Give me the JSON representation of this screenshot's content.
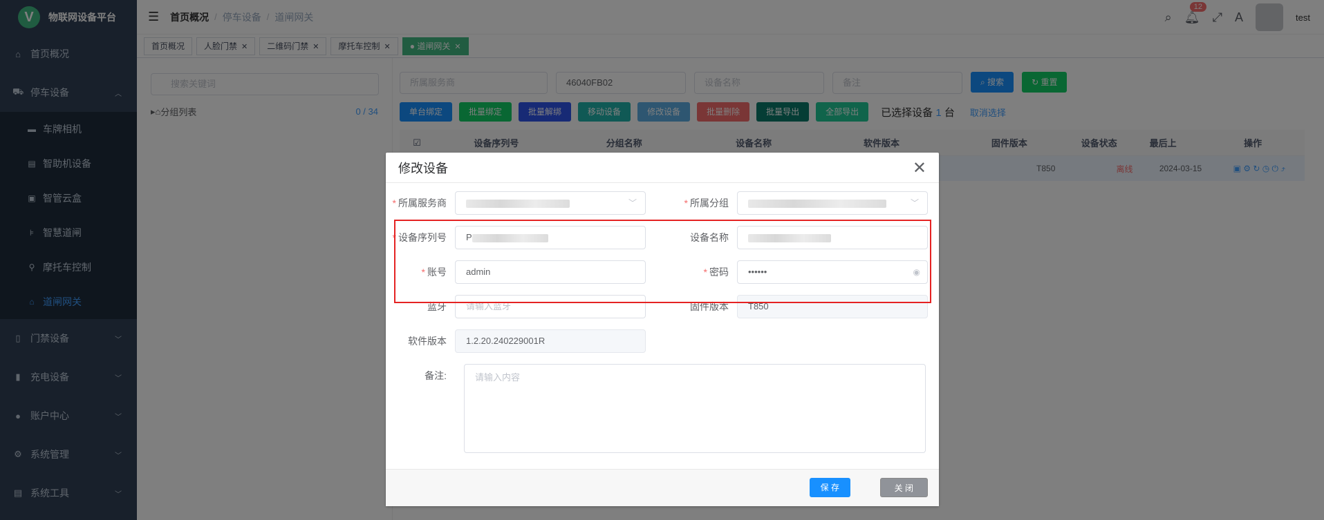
{
  "app": {
    "title": "物联网设备平台",
    "logo_letter": "V"
  },
  "sidebar": {
    "items": [
      {
        "label": "首页概况",
        "icon": "home-icon"
      },
      {
        "label": "停车设备",
        "icon": "car-icon",
        "expanded": true
      },
      {
        "label": "门禁设备",
        "icon": "door-icon"
      },
      {
        "label": "充电设备",
        "icon": "charge-icon"
      },
      {
        "label": "账户中心",
        "icon": "user-icon"
      },
      {
        "label": "系统管理",
        "icon": "gear-icon"
      },
      {
        "label": "系统工具",
        "icon": "tool-icon"
      }
    ],
    "sub_items": [
      {
        "label": "车牌相机",
        "icon": "camera-icon"
      },
      {
        "label": "智助机设备",
        "icon": "kiosk-icon"
      },
      {
        "label": "智管云盒",
        "icon": "box-icon"
      },
      {
        "label": "智慧道闸",
        "icon": "gate-icon"
      },
      {
        "label": "摩托车控制",
        "icon": "motorcycle-icon"
      },
      {
        "label": "道闸网关",
        "icon": "gateway-icon",
        "active": true
      }
    ]
  },
  "navbar": {
    "breadcrumb": [
      "首页概况",
      "停车设备",
      "道闸网关"
    ],
    "notification_count": "12",
    "username": "test"
  },
  "tags": [
    {
      "label": "首页概况"
    },
    {
      "label": "人脸门禁"
    },
    {
      "label": "二维码门禁"
    },
    {
      "label": "摩托车控制"
    },
    {
      "label": "道闸网关",
      "active": true
    }
  ],
  "left_panel": {
    "search_placeholder": "搜索关键词",
    "tree_label": "分组列表",
    "tree_count_a": "0",
    "tree_count_sep": " / ",
    "tree_count_b": "34"
  },
  "filters": {
    "provider_placeholder": "所属服务商",
    "serial_value": "46040FB02",
    "name_placeholder": "设备名称",
    "remark_placeholder": "备注",
    "search_label": "搜索",
    "reset_label": "重置"
  },
  "actions": {
    "buttons": [
      "单台绑定",
      "批量绑定",
      "批量解绑",
      "移动设备",
      "修改设备",
      "批量删除",
      "批量导出",
      "全部导出"
    ],
    "selected_prefix": "已选择设备",
    "selected_count": "1",
    "selected_suffix": "台",
    "cancel_select": "取消选择"
  },
  "table": {
    "headers": [
      "设备序列号",
      "分组名称",
      "设备名称",
      "软件版本",
      "固件版本",
      "设备状态",
      "最后上",
      "操作"
    ],
    "row": {
      "firmware": "T850",
      "status": "离线",
      "last": "2024-03-15"
    }
  },
  "dialog": {
    "title": "修改设备",
    "fields": {
      "provider_label": "所属服务商",
      "group_label": "所属分组",
      "serial_label": "设备序列号",
      "serial_prefix": "P",
      "name_label": "设备名称",
      "account_label": "账号",
      "account_value": "admin",
      "password_label": "密码",
      "password_value": "••••••",
      "bluetooth_label": "蓝牙",
      "bluetooth_placeholder": "请输入蓝牙",
      "firmware_label": "固件版本",
      "firmware_value": "T850",
      "software_label": "软件版本",
      "software_value": "1.2.20.240229001R",
      "remark_label": "备注:",
      "remark_placeholder": "请输入内容"
    },
    "save_label": "保 存",
    "close_label": "关 闭"
  }
}
